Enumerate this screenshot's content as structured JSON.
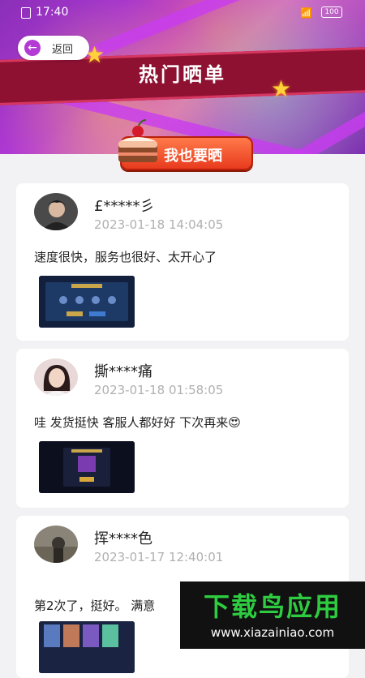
{
  "status_bar": {
    "time": "17:40",
    "battery": "100"
  },
  "header": {
    "back_label": "返回",
    "title": "热门晒单",
    "cta_label": "我也要晒"
  },
  "posts": [
    {
      "username": "£*****彡",
      "timestamp": "2023-01-18 14:04:05",
      "comment": "速度很快，服务也很好、太开心了"
    },
    {
      "username": "撕****痛",
      "timestamp": "2023-01-18 01:58:05",
      "comment": "哇 发货挺快 客服人都好好 下次再来😍"
    },
    {
      "username": "挥****色",
      "timestamp": "2023-01-17 12:40:01",
      "comment": "第2次了，挺好。 满意"
    }
  ],
  "watermark": {
    "title": "下载鸟应用",
    "url": "www.xiazainiao.com"
  },
  "colors": {
    "accent": "#b43ad6",
    "banner": "#8e1132",
    "cta": "#e83b1e",
    "watermark_green": "#2ecc40"
  }
}
